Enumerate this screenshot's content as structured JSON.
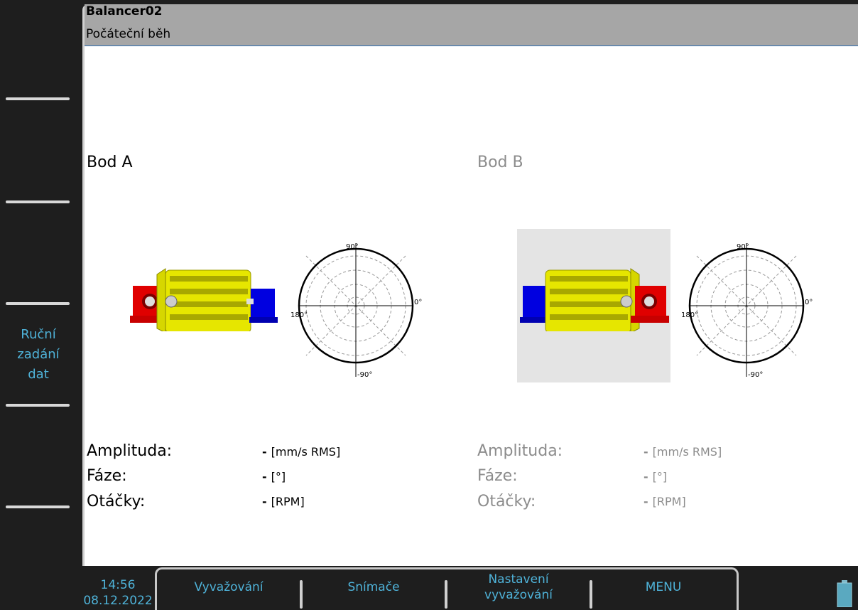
{
  "header": {
    "title": "Balancer02",
    "subtitle": "Počáteční běh"
  },
  "side_keys": [
    {
      "label": ""
    },
    {
      "label": ""
    },
    {
      "label": ""
    },
    {
      "label": "Ruční\nzadání\ndat"
    },
    {
      "label": ""
    },
    {
      "label": ""
    }
  ],
  "point_a": {
    "title": "Bod A",
    "polar": {
      "top": "90°",
      "right": "0°",
      "left": "180°",
      "bottom": "-90°"
    },
    "amplitude": {
      "label": "Amplituda:",
      "value": "-",
      "unit": "[mm/s RMS]"
    },
    "phase": {
      "label": "Fáze:",
      "value": "-",
      "unit": "[°]"
    },
    "speed": {
      "label": "Otáčky:",
      "value": "-",
      "unit": "[RPM]"
    }
  },
  "point_b": {
    "title": "Bod B",
    "polar": {
      "top": "90°",
      "right": "0°",
      "left": "180°",
      "bottom": "-90°"
    },
    "amplitude": {
      "label": "Amplituda:",
      "value": "-",
      "unit": "[mm/s RMS]"
    },
    "phase": {
      "label": "Fáze:",
      "value": "-",
      "unit": "[°]"
    },
    "speed": {
      "label": "Otáčky:",
      "value": "-",
      "unit": "[RPM]"
    }
  },
  "status": {
    "time": "14:56",
    "date": "08.12.2022"
  },
  "bottom_keys": [
    {
      "label": "Vyvažování"
    },
    {
      "label": "Snímače"
    },
    {
      "label": "Nastavení\nvyvažování"
    },
    {
      "label": "MENU"
    }
  ],
  "colors": {
    "accent": "#4fb3d9",
    "active_text": "#000000",
    "inactive_text": "#8c8c8c",
    "rotor": "#ffff00",
    "bearing_red": "#ff0000",
    "bearing_blue": "#0000ff"
  }
}
